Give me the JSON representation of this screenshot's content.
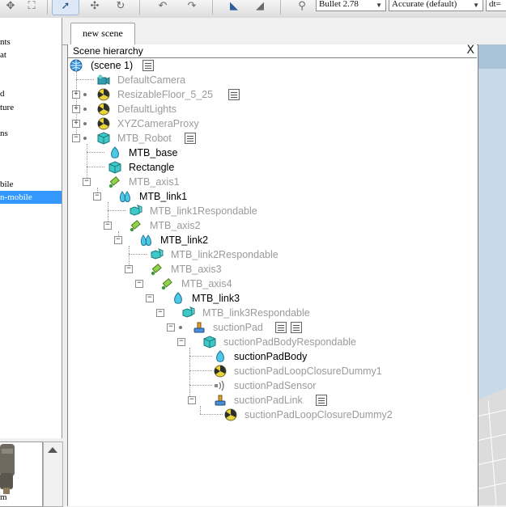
{
  "toolbar": {
    "engine_dropdown": "Bullet 2.78",
    "accuracy_dropdown": "Accurate (default)",
    "third_dropdown": "dt="
  },
  "left_panel": {
    "items": [
      {
        "label": "nts",
        "selected": false
      },
      {
        "label": "at",
        "selected": false
      },
      {
        "label": "d",
        "selected": false
      },
      {
        "label": "ture",
        "selected": false
      },
      {
        "label": "ns",
        "selected": false
      },
      {
        "label": "bile",
        "selected": false
      },
      {
        "label": "n-mobile",
        "selected": true
      }
    ],
    "thumbnail_caption": "m"
  },
  "tab": {
    "label": "new scene"
  },
  "hierarchy": {
    "title": "Scene hierarchy",
    "close_glyph": "X",
    "root_label": "(scene 1)",
    "nodes": [
      {
        "label": "DefaultCamera",
        "icon": "camera-icon",
        "dim": true
      },
      {
        "label": "ResizableFloor_5_25",
        "icon": "dummy-icon",
        "dim": true
      },
      {
        "label": "DefaultLights",
        "icon": "dummy-icon",
        "dim": true
      },
      {
        "label": "XYZCameraProxy",
        "icon": "dummy-icon",
        "dim": true
      },
      {
        "label": "MTB_Robot",
        "icon": "cube-icon",
        "dim": true
      },
      {
        "label": "MTB_base",
        "icon": "shape-icon",
        "dim": false
      },
      {
        "label": "Rectangle",
        "icon": "cube-icon",
        "dim": false
      },
      {
        "label": "MTB_axis1",
        "icon": "joint-icon",
        "dim": true
      },
      {
        "label": "MTB_link1",
        "icon": "multishape-icon",
        "dim": false
      },
      {
        "label": "MTB_link1Respondable",
        "icon": "cubes-icon",
        "dim": true
      },
      {
        "label": "MTB_axis2",
        "icon": "joint-icon",
        "dim": true
      },
      {
        "label": "MTB_link2",
        "icon": "multishape-icon",
        "dim": false
      },
      {
        "label": "MTB_link2Respondable",
        "icon": "cubes-icon",
        "dim": true
      },
      {
        "label": "MTB_axis3",
        "icon": "joint-icon",
        "dim": true
      },
      {
        "label": "MTB_axis4",
        "icon": "joint-icon",
        "dim": true
      },
      {
        "label": "MTB_link3",
        "icon": "shape-icon",
        "dim": false
      },
      {
        "label": "MTB_link3Respondable",
        "icon": "cubes-icon",
        "dim": true
      },
      {
        "label": "suctionPad",
        "icon": "model-icon",
        "dim": true
      },
      {
        "label": "suctionPadBodyRespondable",
        "icon": "cube-icon",
        "dim": true
      },
      {
        "label": "suctionPadBody",
        "icon": "shape-icon",
        "dim": false
      },
      {
        "label": "suctionPadLoopClosureDummy1",
        "icon": "dummy-icon",
        "dim": true
      },
      {
        "label": "suctionPadSensor",
        "icon": "sensor-icon",
        "dim": true
      },
      {
        "label": "suctionPadLink",
        "icon": "model-icon",
        "dim": true
      },
      {
        "label": "suctionPadLoopClosureDummy2",
        "icon": "dummy-icon",
        "dim": true
      }
    ]
  }
}
